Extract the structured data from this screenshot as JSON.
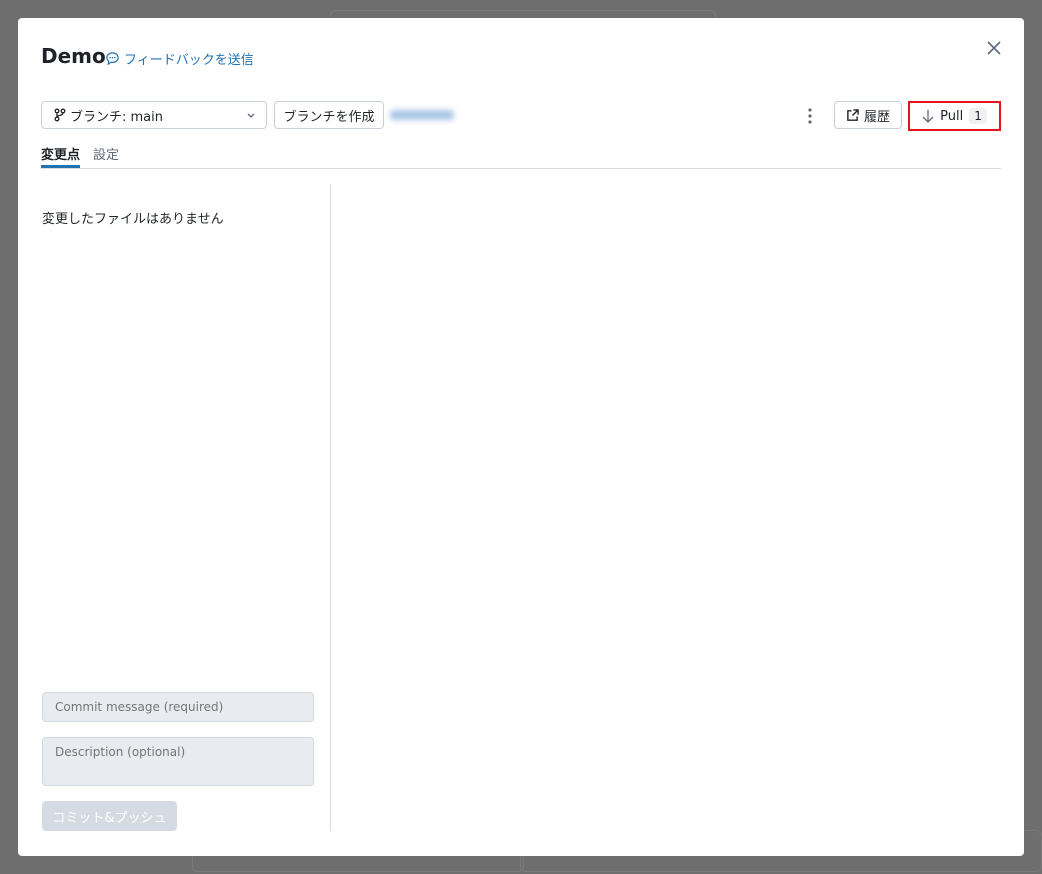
{
  "dialog": {
    "title": "Demo",
    "feedback_link": "フィードバックを送信",
    "branch_select": "ブランチ: main",
    "create_branch": "ブランチを作成",
    "history_button": "履歴",
    "pull_button": "Pull",
    "pull_count": "1",
    "tabs": [
      {
        "label": "変更点"
      },
      {
        "label": "設定"
      }
    ],
    "empty_message": "変更したファイルはありません",
    "commit_placeholder": "Commit message (required)",
    "description_placeholder": "Description (optional)",
    "commit_push_button": "コミット&プッシュ",
    "colors": {
      "accent": "#2272b4",
      "highlight": "#e5141e"
    }
  }
}
